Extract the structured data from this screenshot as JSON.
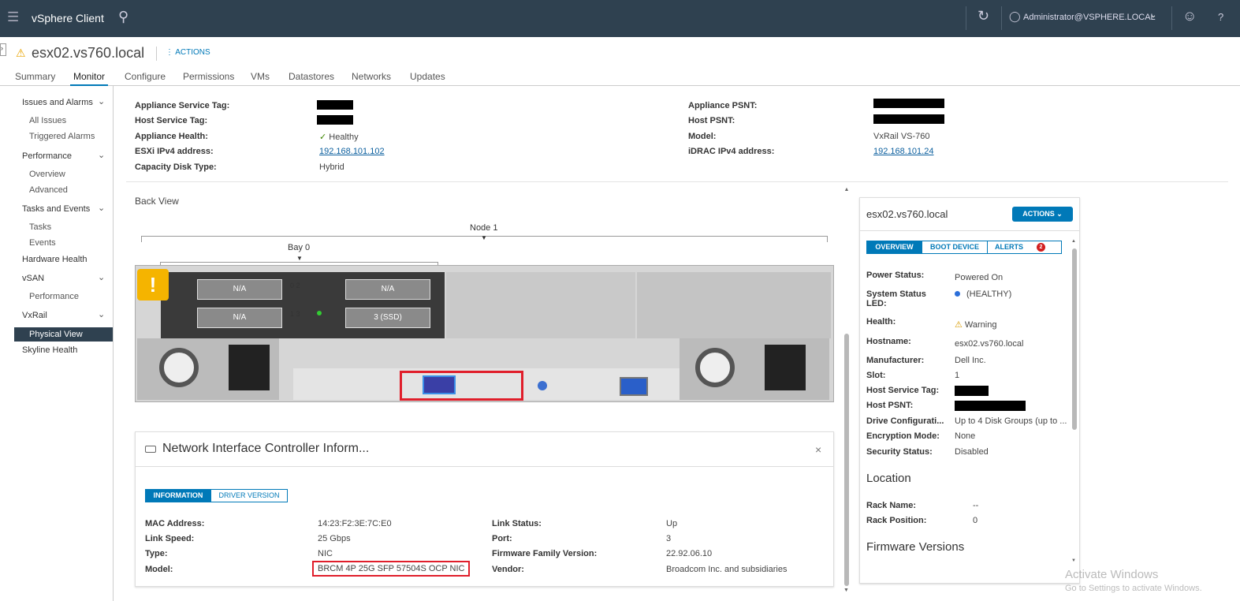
{
  "header": {
    "app_title": "vSphere Client",
    "user": "Administrator@VSPHERE.LOCAL"
  },
  "object": {
    "name": "esx02.vs760.local",
    "actions": "ACTIONS"
  },
  "tabs": [
    "Summary",
    "Monitor",
    "Configure",
    "Permissions",
    "VMs",
    "Datastores",
    "Networks",
    "Updates"
  ],
  "sidebar": {
    "groups": [
      {
        "label": "Issues and Alarms",
        "items": [
          "All Issues",
          "Triggered Alarms"
        ]
      },
      {
        "label": "Performance",
        "items": [
          "Overview",
          "Advanced"
        ]
      },
      {
        "label": "Tasks and Events",
        "items": [
          "Tasks",
          "Events"
        ]
      }
    ],
    "hardware_health": "Hardware Health",
    "vsan": {
      "label": "vSAN",
      "items": [
        "Performance"
      ]
    },
    "vxrail": {
      "label": "VxRail",
      "items": [
        "Physical View"
      ]
    },
    "skyline": "Skyline Health"
  },
  "summary": {
    "appliance_service_tag": "Appliance Service Tag:",
    "host_service_tag": "Host Service Tag:",
    "appliance_health": "Appliance Health:",
    "appliance_health_value": "Healthy",
    "esxi_ipv4": "ESXi IPv4 address:",
    "esxi_ipv4_value": "192.168.101.102",
    "capacity_disk_type": "Capacity Disk Type:",
    "capacity_disk_type_value": "Hybrid",
    "appliance_psnt": "Appliance PSNT:",
    "host_psnt": "Host PSNT:",
    "model": "Model:",
    "model_value": "VxRail VS-760",
    "idrac_ipv4": "iDRAC IPv4 address:",
    "idrac_ipv4_value": "192.168.101.24"
  },
  "back_view": {
    "title": "Back View",
    "node": "Node 1",
    "bay": "Bay 0",
    "slots": [
      "N/A",
      "N/A",
      "N/A",
      "3 (SSD)"
    ],
    "slot_nums": [
      "0 2",
      "1 3"
    ]
  },
  "nic": {
    "title": "Network Interface Controller Inform...",
    "tabs": [
      "INFORMATION",
      "DRIVER VERSION"
    ],
    "left": [
      [
        "MAC Address:",
        "14:23:F2:3E:7C:E0"
      ],
      [
        "Link Speed:",
        "25 Gbps"
      ],
      [
        "Type:",
        "NIC"
      ],
      [
        "Model:",
        "BRCM 4P 25G SFP 57504S OCP NIC"
      ]
    ],
    "right": [
      [
        "Link Status:",
        "Up"
      ],
      [
        "Port:",
        "3"
      ],
      [
        "Firmware Family Version:",
        "22.92.06.10"
      ],
      [
        "Vendor:",
        "Broadcom Inc. and subsidiaries"
      ]
    ]
  },
  "host_panel": {
    "title": "esx02.vs760.local",
    "actions": "ACTIONS",
    "tabs": [
      "OVERVIEW",
      "BOOT DEVICE",
      "ALERTS"
    ],
    "alerts_count": "2",
    "rows": [
      [
        "Power Status:",
        "Powered On"
      ],
      [
        "System Status LED:",
        "(HEALTHY)"
      ],
      [
        "Health:",
        "Warning"
      ],
      [
        "Hostname:",
        "esx02.vs760.local"
      ],
      [
        "Manufacturer:",
        "Dell Inc."
      ],
      [
        "Slot:",
        "1"
      ],
      [
        "Host Service Tag:",
        ""
      ],
      [
        "Host PSNT:",
        ""
      ],
      [
        "Drive Configurati...",
        "Up to 4 Disk Groups (up to ..."
      ],
      [
        "Encryption Mode:",
        "None"
      ],
      [
        "Security Status:",
        "Disabled"
      ]
    ],
    "location": "Location",
    "rack_name": [
      "Rack Name:",
      "--"
    ],
    "rack_position": [
      "Rack Position:",
      "0"
    ],
    "firmware": "Firmware Versions"
  },
  "watermark": {
    "line1": "Activate Windows",
    "line2": "Go to Settings to activate Windows."
  }
}
